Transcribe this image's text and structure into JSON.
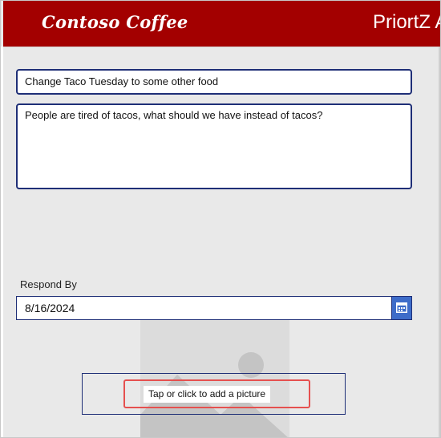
{
  "header": {
    "logo_text": "Contoso Coffee",
    "app_title": "PriortZ A",
    "background_color": "#a30000"
  },
  "form": {
    "title_value": "Change Taco Tuesday to some other food",
    "description_value": "People are tired of tacos, what should we have instead of tacos?",
    "respond_by_label": "Respond By",
    "respond_by_value": "8/16/2024",
    "calendar_icon": "calendar-icon",
    "add_picture_label": "Tap or click to add a picture",
    "image_placeholder_icon": "add-picture-icon"
  },
  "colors": {
    "field_border": "#1f2f77",
    "accent_button": "#3e6cc9",
    "highlight": "#e5504f"
  }
}
